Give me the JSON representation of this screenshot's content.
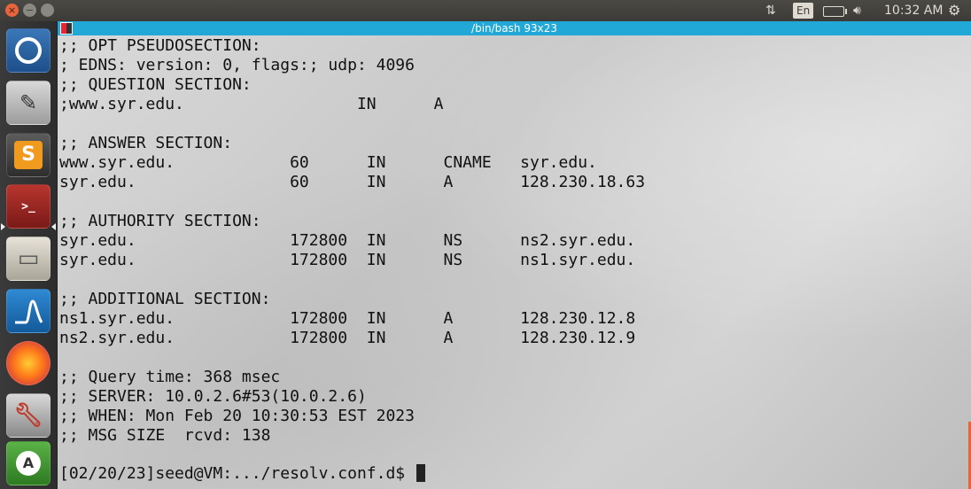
{
  "top_panel": {
    "language": "En",
    "clock": "10:32 AM",
    "icons": [
      "network-arrows-icon",
      "battery-icon",
      "volume-icon",
      "gear-icon"
    ]
  },
  "launcher": {
    "items": [
      {
        "name": "ubuntu-dash",
        "icon": "ubuntu-logo-icon"
      },
      {
        "name": "text-editor",
        "icon": "text-editor-icon"
      },
      {
        "name": "sublime-text",
        "icon": "sublime-icon",
        "glyph": "S"
      },
      {
        "name": "terminal",
        "icon": "terminal-icon",
        "active": true
      },
      {
        "name": "files",
        "icon": "files-icon"
      },
      {
        "name": "wireshark",
        "icon": "wireshark-icon"
      },
      {
        "name": "firefox",
        "icon": "firefox-icon"
      },
      {
        "name": "system-settings",
        "icon": "settings-icon"
      },
      {
        "name": "software-updater",
        "icon": "updater-icon",
        "glyph": "A"
      }
    ]
  },
  "terminal": {
    "title": "/bin/bash 93x23",
    "lines": [
      ";; OPT PSEUDOSECTION:",
      "; EDNS: version: 0, flags:; udp: 4096",
      ";; QUESTION SECTION:",
      ";www.syr.edu.                  IN      A",
      "",
      ";; ANSWER SECTION:",
      "www.syr.edu.            60      IN      CNAME   syr.edu.",
      "syr.edu.                60      IN      A       128.230.18.63",
      "",
      ";; AUTHORITY SECTION:",
      "syr.edu.                172800  IN      NS      ns2.syr.edu.",
      "syr.edu.                172800  IN      NS      ns1.syr.edu.",
      "",
      ";; ADDITIONAL SECTION:",
      "ns1.syr.edu.            172800  IN      A       128.230.12.8",
      "ns2.syr.edu.            172800  IN      A       128.230.12.9",
      "",
      ";; Query time: 368 msec",
      ";; SERVER: 10.0.2.6#53(10.0.2.6)",
      ";; WHEN: Mon Feb 20 10:30:53 EST 2023",
      ";; MSG SIZE  rcvd: 138"
    ],
    "prompt": "[02/20/23]seed@VM:.../resolv.conf.d$ "
  }
}
